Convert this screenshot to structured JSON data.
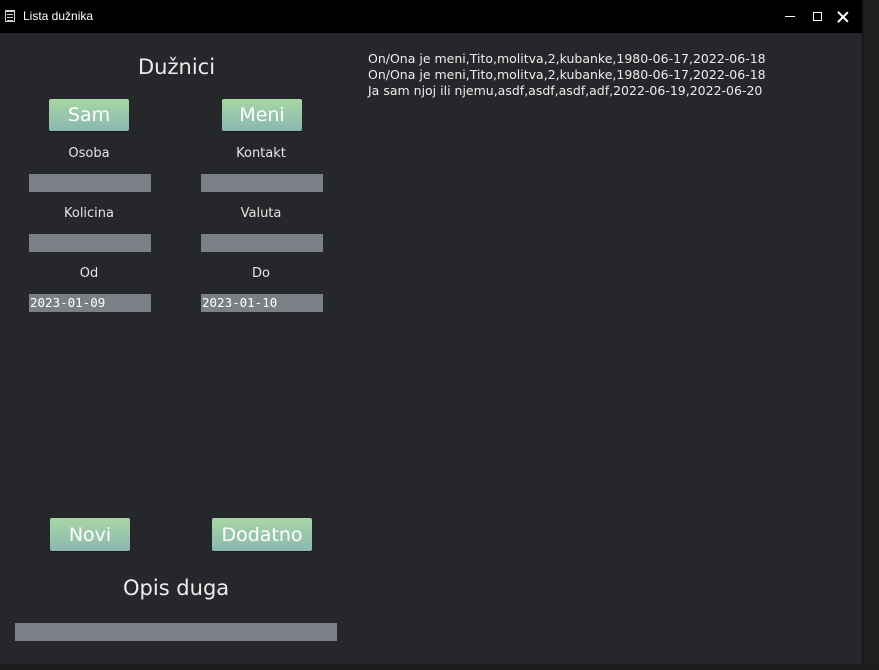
{
  "window": {
    "title": "Lista dužnika",
    "icon": "clipboard-icon"
  },
  "left": {
    "title": "Dužnici",
    "sam_button": "Sam",
    "meni_button": "Meni",
    "labels": {
      "osoba": "Osoba",
      "kontakt": "Kontakt",
      "kolicina": "Kolicina",
      "valuta": "Valuta",
      "od": "Od",
      "do": "Do"
    },
    "fields": {
      "osoba": "",
      "kontakt": "",
      "kolicina": "",
      "valuta": "",
      "od": "2023-01-09",
      "do": "2023-01-10"
    },
    "novi_button": "Novi",
    "dodatno_button": "Dodatno",
    "opis_title": "Opis duga",
    "opis_value": ""
  },
  "output": {
    "lines": [
      "On/Ona je meni,Tito,molitva,2,kubanke,1980-06-17,2022-06-18",
      "On/Ona je meni,Tito,molitva,2,kubanke,1980-06-17,2022-06-18",
      "Ja sam njoj ili njemu,asdf,asdf,asdf,adf,2022-06-19,2022-06-20"
    ]
  },
  "colors": {
    "window_bg": "#25272a",
    "titlebar_bg": "#000000",
    "field_bg": "#7b8087",
    "button_gradient_top": "#a8d6a3",
    "button_gradient_bottom": "#8ab8b1"
  }
}
